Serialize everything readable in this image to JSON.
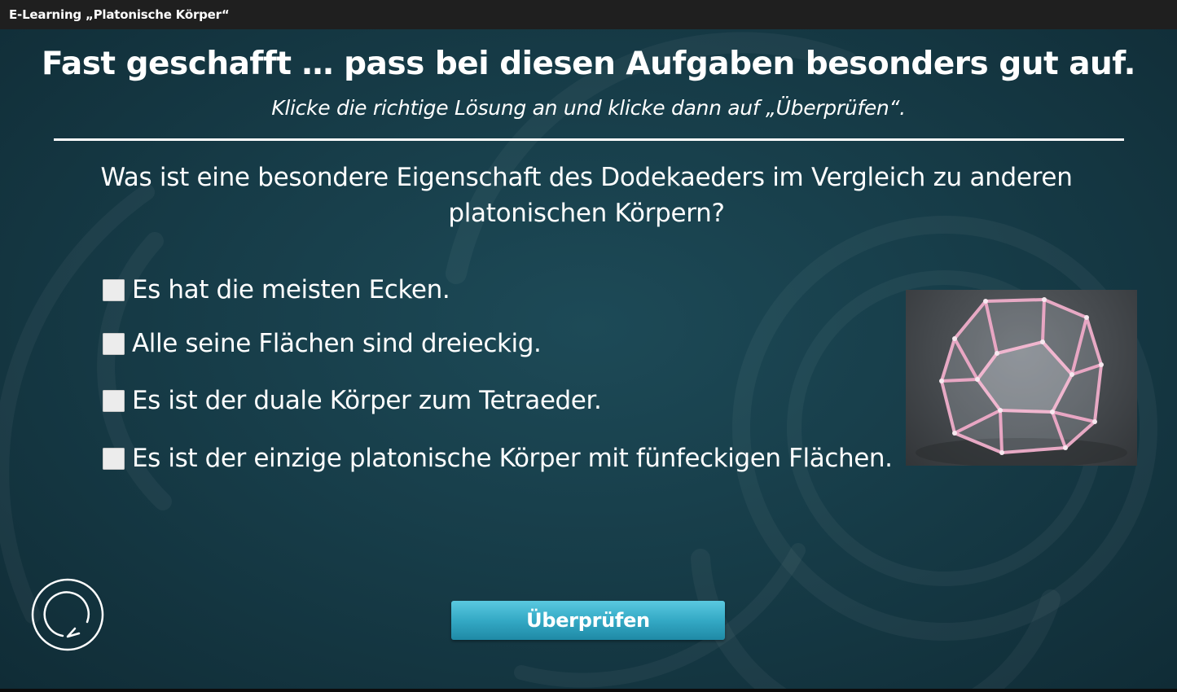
{
  "window": {
    "title": "E-Learning „Platonische Körper“"
  },
  "slide": {
    "heading": "Fast geschafft … pass bei diesen Aufgaben besonders gut auf.",
    "instruction": "Klicke die richtige Lösung an und klicke dann auf „Überprüfen“.",
    "question": "Was ist eine besondere Eigenschaft des Dodekaeders im Vergleich zu anderen platonischen Körpern?",
    "options": [
      {
        "label": "Es hat die meisten Ecken.",
        "checked": false
      },
      {
        "label": "Alle seine Flächen sind dreieckig.",
        "checked": false
      },
      {
        "label": "Es ist der duale Körper zum Tetraeder.",
        "checked": false
      },
      {
        "label": "Es ist der einzige platonische Körper mit fünfeckigen Flächen.",
        "checked": false
      }
    ],
    "check_button_label": "Überprüfen",
    "reset_icon": "reset-icon",
    "image_subject": "dodecahedron-model"
  },
  "colors": {
    "background": "#173d49",
    "button": "#34a9c5",
    "text": "#ffffff"
  }
}
